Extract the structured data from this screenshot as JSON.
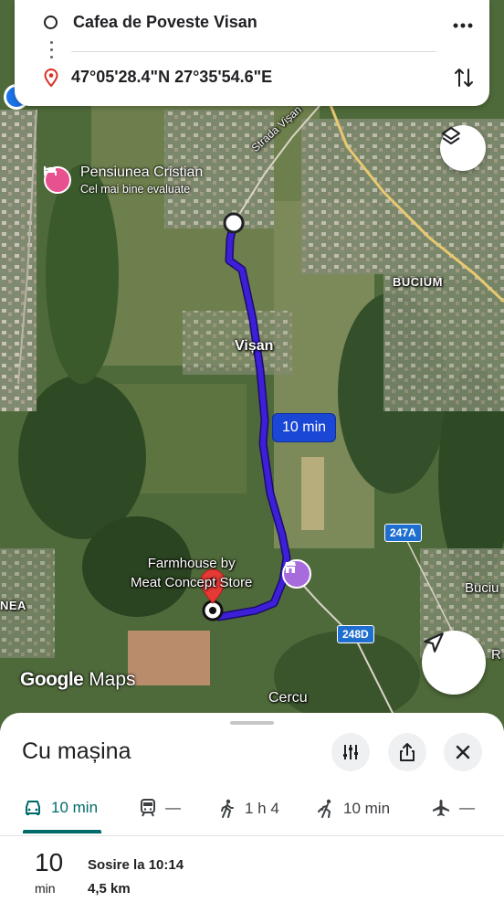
{
  "route_card": {
    "origin": "Cafea de Poveste Visan",
    "destination": "47°05'28.4\"N 27°35'54.6\"E",
    "more_icon": "more-horiz-icon",
    "swap_icon": "swap-vert-icon"
  },
  "map": {
    "place_labels": {
      "visan": "Vișan",
      "bucium": "BUCIUM",
      "buciu_partial": "Buciu",
      "nea_partial": "NEA",
      "cercu": "Cercu",
      "r_partial": "R",
      "strada_visan": "Strada Vișan"
    },
    "pension": {
      "name": "Pensiunea Cristian",
      "rating_note": "Cel mai bine evaluate"
    },
    "farmhouse": {
      "line1": "Farmhouse by",
      "line2": "Meat Concept Store"
    },
    "road_badges": {
      "road_a": "247A",
      "road_b": "248D"
    },
    "route_time_bubble": "10 min",
    "attribution": {
      "google": "Google",
      "maps": "Maps"
    },
    "route_color": "#3d1fd9"
  },
  "sheet": {
    "title": "Cu mașina",
    "modes": [
      {
        "name": "car",
        "label": "10 min",
        "active": true
      },
      {
        "name": "transit",
        "label": "—"
      },
      {
        "name": "walk",
        "label": "1 h 4"
      },
      {
        "name": "ride",
        "label": "10 min"
      },
      {
        "name": "flight",
        "label": "—"
      }
    ],
    "trip": {
      "minutes": "10",
      "unit": "min",
      "arrival": "Sosire la 10:14",
      "distance": "4,5 km"
    }
  },
  "accent_color": "#006a6a"
}
